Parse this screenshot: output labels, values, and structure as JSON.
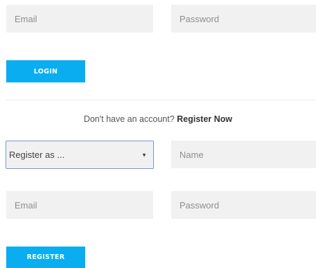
{
  "login": {
    "email_placeholder": "Email",
    "password_placeholder": "Password",
    "button_label": "LOGIN"
  },
  "account_prompt": {
    "text": "Don't have an account?",
    "link": "Register Now"
  },
  "register": {
    "role_select_value": "Register as ...",
    "name_placeholder": "Name",
    "email_placeholder": "Email",
    "password_placeholder": "Password",
    "button_label": "REGISTER"
  },
  "colors": {
    "accent": "#0aaef0",
    "field_bg": "#f1f1f1",
    "select_border": "#7b96c9"
  },
  "icons": {
    "select_caret": "chevron-down-icon"
  }
}
